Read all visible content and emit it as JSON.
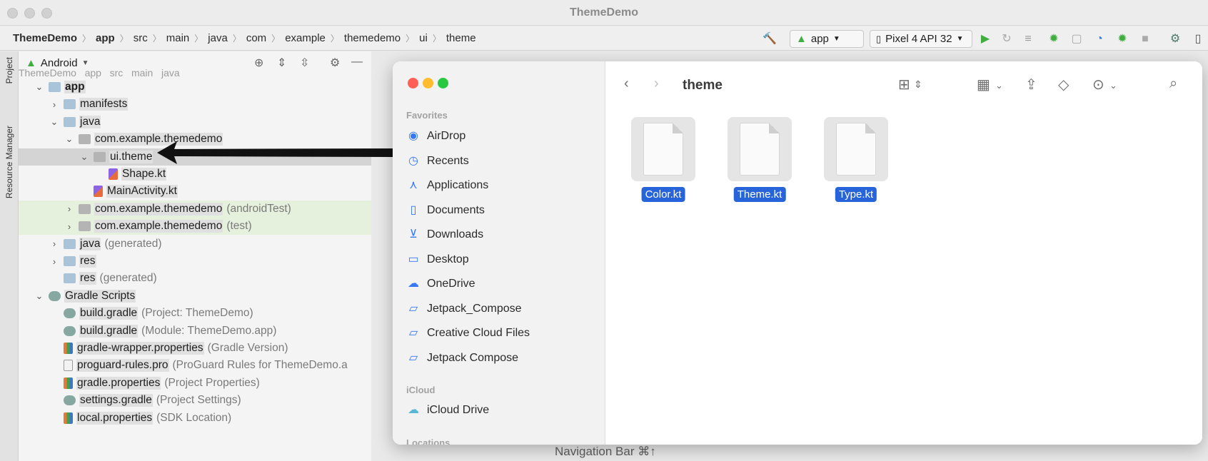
{
  "window": {
    "title": "ThemeDemo"
  },
  "breadcrumb": [
    "ThemeDemo",
    "app",
    "src",
    "main",
    "java",
    "com",
    "example",
    "themedemo",
    "ui",
    "theme"
  ],
  "toolbar": {
    "run_config": "app",
    "device": "Pixel 4 API 32"
  },
  "left_strip": {
    "project_tab": "Project",
    "resource_manager_tab": "Resource Manager"
  },
  "project_pane": {
    "view_selector": "Android",
    "tree": [
      {
        "label": "app",
        "muted": "",
        "indent": 0,
        "expanded": true,
        "icon": "folder"
      },
      {
        "label": "manifests",
        "muted": "",
        "indent": 1,
        "expanded": false,
        "icon": "folder"
      },
      {
        "label": "java",
        "muted": "",
        "indent": 1,
        "expanded": true,
        "icon": "folder"
      },
      {
        "label": "com.example.themedemo",
        "muted": "",
        "indent": 2,
        "expanded": true,
        "icon": "greyfolder"
      },
      {
        "label": "ui.theme",
        "muted": "",
        "indent": 3,
        "expanded": true,
        "icon": "greyfolder"
      },
      {
        "label": "Shape.kt",
        "muted": "",
        "indent": 4,
        "expanded": null,
        "icon": "kt"
      },
      {
        "label": "MainActivity.kt",
        "muted": "",
        "indent": 3,
        "expanded": null,
        "icon": "kt"
      },
      {
        "label": "com.example.themedemo",
        "muted": "(androidTest)",
        "indent": 2,
        "expanded": false,
        "icon": "greyfolder"
      },
      {
        "label": "com.example.themedemo",
        "muted": "(test)",
        "indent": 2,
        "expanded": false,
        "icon": "greyfolder"
      },
      {
        "label": "java",
        "muted": "(generated)",
        "indent": 1,
        "expanded": false,
        "icon": "folder"
      },
      {
        "label": "res",
        "muted": "",
        "indent": 1,
        "expanded": false,
        "icon": "folder"
      },
      {
        "label": "res",
        "muted": "(generated)",
        "indent": 1,
        "expanded": null,
        "icon": "folder"
      },
      {
        "label": "Gradle Scripts",
        "muted": "",
        "indent": 0,
        "expanded": true,
        "icon": "gradle"
      },
      {
        "label": "build.gradle",
        "muted": "(Project: ThemeDemo)",
        "indent": 1,
        "expanded": null,
        "icon": "gradle"
      },
      {
        "label": "build.gradle",
        "muted": "(Module: ThemeDemo.app)",
        "indent": 1,
        "expanded": null,
        "icon": "gradle"
      },
      {
        "label": "gradle-wrapper.properties",
        "muted": "(Gradle Version)",
        "indent": 1,
        "expanded": null,
        "icon": "props"
      },
      {
        "label": "proguard-rules.pro",
        "muted": "(ProGuard Rules for ThemeDemo.a",
        "indent": 1,
        "expanded": null,
        "icon": "file"
      },
      {
        "label": "gradle.properties",
        "muted": "(Project Properties)",
        "indent": 1,
        "expanded": null,
        "icon": "props"
      },
      {
        "label": "settings.gradle",
        "muted": "(Project Settings)",
        "indent": 1,
        "expanded": null,
        "icon": "gradle"
      },
      {
        "label": "local.properties",
        "muted": "(SDK Location)",
        "indent": 1,
        "expanded": null,
        "icon": "props"
      }
    ]
  },
  "finder": {
    "current_folder": "theme",
    "favorites_header": "Favorites",
    "favorites": [
      {
        "label": "AirDrop",
        "icon": "airdrop-icon"
      },
      {
        "label": "Recents",
        "icon": "clock-icon"
      },
      {
        "label": "Applications",
        "icon": "applications-icon"
      },
      {
        "label": "Documents",
        "icon": "document-icon"
      },
      {
        "label": "Downloads",
        "icon": "download-icon"
      },
      {
        "label": "Desktop",
        "icon": "desktop-icon"
      },
      {
        "label": "OneDrive",
        "icon": "cloud-icon"
      },
      {
        "label": "Jetpack_Compose",
        "icon": "folder-icon"
      },
      {
        "label": "Creative Cloud Files",
        "icon": "folder-icon"
      },
      {
        "label": "Jetpack Compose",
        "icon": "folder-icon"
      }
    ],
    "icloud_header": "iCloud",
    "icloud": [
      {
        "label": "iCloud Drive",
        "icon": "icloud-icon"
      }
    ],
    "locations_header": "Locations",
    "files": [
      "Color.kt",
      "Theme.kt",
      "Type.kt"
    ]
  },
  "status": {
    "navigation_bar": "Navigation Bar ⌘↑"
  },
  "colors": {
    "selection": "#2764d9",
    "finder_red": "#fe5f57",
    "finder_yellow": "#febc2e",
    "finder_green": "#28c840",
    "run_green": "#3fae3f",
    "test_row": "#e6f1dd"
  }
}
